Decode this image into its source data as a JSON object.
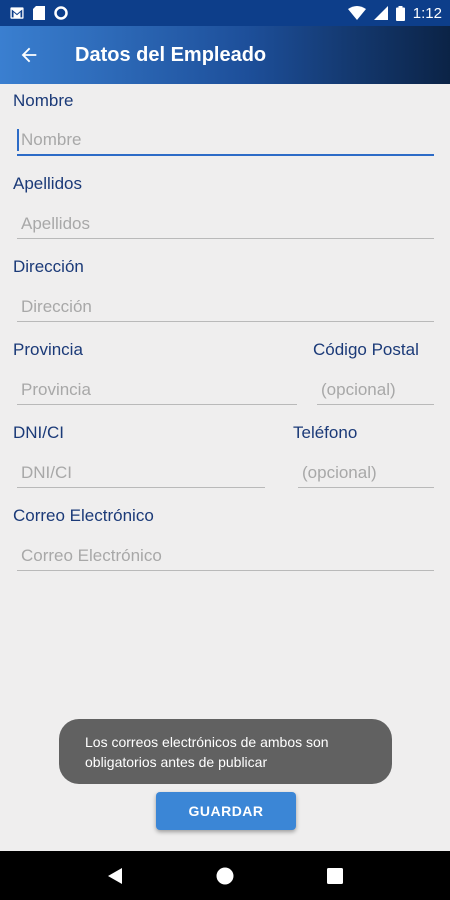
{
  "status_bar": {
    "time": "1:12",
    "icons": [
      "gmail-icon",
      "sd-card-icon",
      "circle-icon",
      "wifi-icon",
      "signal-icon",
      "battery-icon"
    ]
  },
  "app_bar": {
    "title": "Datos del Empleado",
    "back_icon": "arrow-back-icon"
  },
  "form": {
    "nombre": {
      "label": "Nombre",
      "placeholder": "Nombre"
    },
    "apellidos": {
      "label": "Apellidos",
      "placeholder": "Apellidos"
    },
    "direccion": {
      "label": "Dirección",
      "placeholder": "Dirección"
    },
    "provincia": {
      "label": "Provincia",
      "placeholder": "Provincia"
    },
    "codigo_postal": {
      "label": "Código Postal",
      "placeholder": "(opcional)"
    },
    "dni": {
      "label": "DNI/CI",
      "placeholder": "DNI/CI"
    },
    "telefono": {
      "label": "Teléfono",
      "placeholder": "(opcional)"
    },
    "correo": {
      "label": "Correo Electrónico",
      "placeholder": "Correo Electrónico"
    }
  },
  "toast": {
    "message": "Los correos electrónicos de ambos son obligatorios antes de publicar"
  },
  "actions": {
    "save_label": "GUARDAR"
  },
  "colors": {
    "accent": "#2c6bc7",
    "label": "#1b3a78",
    "button": "#3b86d6",
    "toast": "#616161"
  }
}
